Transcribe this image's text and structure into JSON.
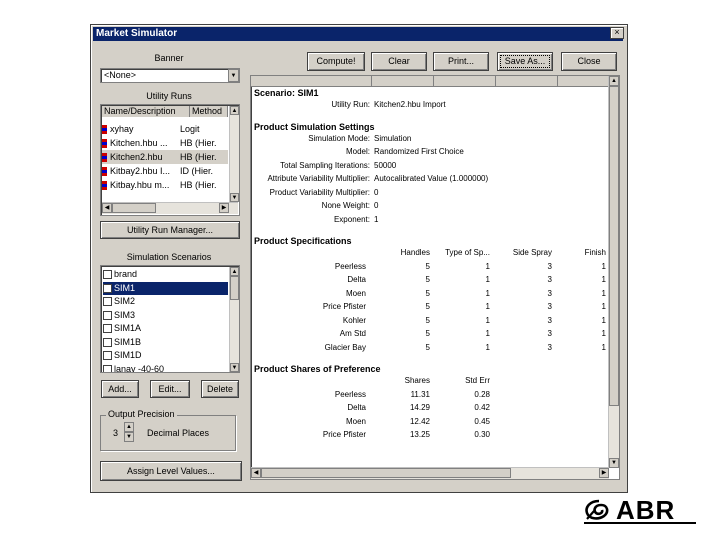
{
  "window": {
    "title": "Market Simulator",
    "close_glyph": "×"
  },
  "banner": {
    "label": "Banner",
    "value": "<None>"
  },
  "utility_runs": {
    "label": "Utility Runs",
    "columns": [
      "Name/Description",
      "Method"
    ],
    "rows": [
      {
        "name": "xyhay",
        "method": "Logit"
      },
      {
        "name": "Kitchen.hbu ...",
        "method": "HB (Hier."
      },
      {
        "name": "Kitchen2.hbu",
        "method": "HB (Hier."
      },
      {
        "name": "Kitbay2.hbu I...",
        "method": "ID (Hier."
      },
      {
        "name": "Kitbay.hbu m...",
        "method": "HB (Hier."
      }
    ],
    "manager_button": "Utility Run Manager..."
  },
  "scenarios": {
    "label": "Simulation Scenarios",
    "items": [
      {
        "label": "brand",
        "checked": ""
      },
      {
        "label": "SIM1",
        "checked": "✓"
      },
      {
        "label": "SIM2",
        "checked": ""
      },
      {
        "label": "SIM3",
        "checked": ""
      },
      {
        "label": "SIM1A",
        "checked": ""
      },
      {
        "label": "SIM1B",
        "checked": ""
      },
      {
        "label": "SIM1D",
        "checked": ""
      },
      {
        "label": "lanay -40-60",
        "checked": ""
      }
    ],
    "add": "Add...",
    "edit": "Edit...",
    "delete": "Delete"
  },
  "output_precision": {
    "label": "Output Precision",
    "value": "3",
    "unit": "Decimal Places"
  },
  "assign_button": "Assign Level Values...",
  "toolbar": {
    "compute": "Compute!",
    "clear": "Clear",
    "print": "Print...",
    "save_as": "Save As...",
    "close": "Close"
  },
  "report": {
    "scenario": "Scenario: SIM1",
    "utility_run_label": "Utility Run:",
    "utility_run_value": "Kitchen2.hbu Import",
    "settings_title": "Product Simulation Settings",
    "settings": [
      {
        "k": "Simulation Mode:",
        "v": "Simulation"
      },
      {
        "k": "Model:",
        "v": "Randomized First Choice"
      },
      {
        "k": "Total Sampling Iterations:",
        "v": "50000"
      },
      {
        "k": "Attribute Variability Multiplier:",
        "v": "Autocalibrated Value (1.000000)"
      },
      {
        "k": "Product Variability Multiplier:",
        "v": "0"
      },
      {
        "k": "None Weight:",
        "v": "0"
      },
      {
        "k": "Exponent:",
        "v": "1"
      }
    ],
    "specs_title": "Product Specifications",
    "spec_columns": [
      "Handles",
      "Type of Sp...",
      "Side Spray",
      "Finish"
    ],
    "specs": [
      {
        "name": "Peerless",
        "vals": [
          "5",
          "1",
          "3",
          "1"
        ]
      },
      {
        "name": "Delta",
        "vals": [
          "5",
          "1",
          "3",
          "1"
        ]
      },
      {
        "name": "Moen",
        "vals": [
          "5",
          "1",
          "3",
          "1"
        ]
      },
      {
        "name": "Price Pfister",
        "vals": [
          "5",
          "1",
          "3",
          "1"
        ]
      },
      {
        "name": "Kohler",
        "vals": [
          "5",
          "1",
          "3",
          "1"
        ]
      },
      {
        "name": "Am Std",
        "vals": [
          "5",
          "1",
          "3",
          "1"
        ]
      },
      {
        "name": "Glacier Bay",
        "vals": [
          "5",
          "1",
          "3",
          "1"
        ]
      }
    ],
    "shares_title": "Product Shares of Preference",
    "share_columns": [
      "Shares",
      "Std Err"
    ],
    "shares": [
      {
        "name": "Peerless",
        "share": "11.31",
        "err": "0.28"
      },
      {
        "name": "Delta",
        "share": "14.29",
        "err": "0.42"
      },
      {
        "name": "Moen",
        "share": "12.42",
        "err": "0.45"
      },
      {
        "name": "Price Pfister",
        "share": "13.25",
        "err": "0.30"
      }
    ]
  },
  "logo": {
    "text": "ABR"
  }
}
